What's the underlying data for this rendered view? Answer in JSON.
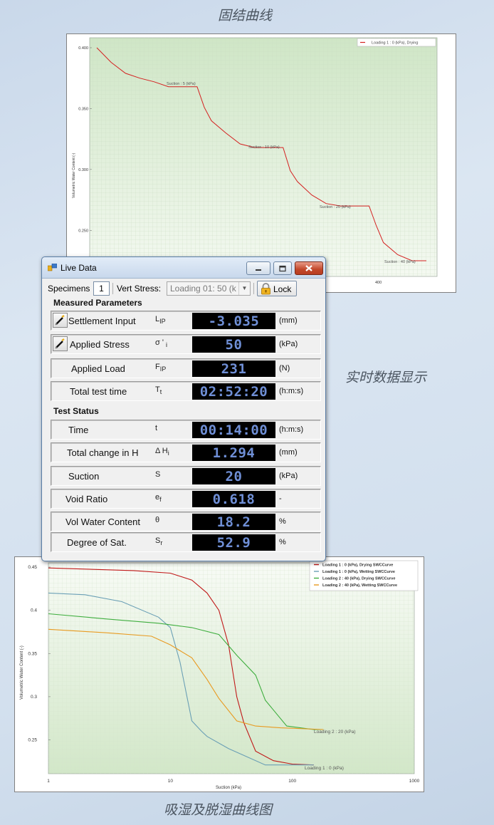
{
  "captions": {
    "consolidation": "固结曲线",
    "live": "实时数据显示",
    "swcc": "吸湿及脱湿曲线图"
  },
  "top_chart": {
    "legend": "Loading 1 : 0 (kPa), Drying",
    "ylabel": "Volumetric Water Content (-)",
    "yticks": [
      "0.400",
      "0.350",
      "0.300",
      "0.250"
    ],
    "xticks": [
      "400"
    ],
    "annotations": [
      "Suction : 5 (kPa)",
      "Suction : 10 (kPa)",
      "Suction : 20 (kPa)",
      "Suction : 40 (kPa)"
    ],
    "line_color": "#d42020"
  },
  "window": {
    "title": "Live Data",
    "specimens_label": "Specimens",
    "specimens_value": "1",
    "vert_stress_label": "Vert Stress:",
    "vert_stress_value": "Loading 01: 50 (k",
    "lock_label": "Lock",
    "measured_title": "Measured Parameters",
    "status_title": "Test Status",
    "measured": [
      {
        "name": "Settlement Input",
        "sym": "L",
        "sub": "IP",
        "value": "-3.035",
        "unit": "(mm)"
      },
      {
        "name": "Applied Stress",
        "sym": "σ ' ",
        "sub": "i",
        "value": "50",
        "unit": "(kPa)"
      },
      {
        "name": "Applied Load",
        "sym": "F",
        "sub": "IP",
        "value": "231",
        "unit": "(N)"
      },
      {
        "name": "Total test time",
        "sym": "T",
        "sub": "t",
        "value": "02:52:20",
        "unit": "(h:m:s)"
      }
    ],
    "status": [
      {
        "name": "Time",
        "sym": "t",
        "sub": "",
        "value": "00:14:00",
        "unit": "(h:m:s)"
      },
      {
        "name": "Total change in H",
        "sym": "Δ H",
        "sub": "i",
        "value": "1.294",
        "unit": "(mm)"
      },
      {
        "name": "Suction",
        "sym": "S",
        "sub": "",
        "value": "20",
        "unit": "(kPa)"
      },
      {
        "name": "Void Ratio",
        "sym": "e",
        "sub": "f",
        "value": "0.618",
        "unit": "-"
      },
      {
        "name": "Vol Water Content",
        "sym": "θ",
        "sub": "",
        "value": "18.2",
        "unit": "%"
      },
      {
        "name": "Degree of Sat.",
        "sym": "S",
        "sub": "r",
        "value": "52.9",
        "unit": "%"
      }
    ]
  },
  "chart_data": [
    {
      "type": "line",
      "ylabel": "Volumetric Water Content (-)",
      "series": [
        {
          "name": "Loading 1 : 0 (kPa), Drying",
          "x": [
            0,
            20,
            40,
            60,
            80,
            100,
            120,
            140,
            150,
            160,
            180,
            200,
            220,
            240,
            260,
            270,
            280,
            300,
            320,
            340,
            360,
            380,
            390,
            400,
            420,
            440,
            460
          ],
          "y": [
            0.4,
            0.388,
            0.379,
            0.375,
            0.372,
            0.368,
            0.368,
            0.368,
            0.351,
            0.34,
            0.33,
            0.321,
            0.318,
            0.318,
            0.318,
            0.299,
            0.29,
            0.279,
            0.272,
            0.27,
            0.27,
            0.27,
            0.254,
            0.24,
            0.23,
            0.225,
            0.225
          ]
        }
      ],
      "annotations": [
        "Suction : 5 (kPa)",
        "Suction : 10 (kPa)",
        "Suction : 20 (kPa)",
        "Suction : 40 (kPa)"
      ]
    },
    {
      "type": "line",
      "xscale": "log",
      "xlabel": "Suction (kPa)",
      "ylabel": "Volumetric Water Content (-)",
      "xlim": [
        1,
        1000
      ],
      "ylim": [
        0.21,
        0.45
      ],
      "xticks": [
        "1",
        "10",
        "100",
        "1000"
      ],
      "yticks": [
        "0.45",
        "0.4",
        "0.35",
        "0.3",
        "0.25"
      ],
      "series": [
        {
          "name": "Loading 1 : 0 (kPa), Drying SWCCurve",
          "color": "#c01818",
          "x": [
            1,
            5,
            10,
            15,
            20,
            25,
            30,
            35,
            40,
            50,
            70,
            100,
            150
          ],
          "y": [
            0.449,
            0.446,
            0.443,
            0.435,
            0.42,
            0.4,
            0.36,
            0.3,
            0.27,
            0.237,
            0.226,
            0.222,
            0.221
          ]
        },
        {
          "name": "Loading 1 : 0 (kPa), Wetting SWCCurve",
          "color": "#6a9fb5",
          "x": [
            1,
            2,
            4,
            8,
            10,
            12,
            15,
            18,
            20,
            30,
            60,
            100,
            150
          ],
          "y": [
            0.42,
            0.418,
            0.41,
            0.392,
            0.38,
            0.34,
            0.272,
            0.26,
            0.254,
            0.24,
            0.221,
            0.221,
            0.221
          ]
        },
        {
          "name": "Loading 2 : 40 (kPa), Drying SWCCurve",
          "color": "#3fae3f",
          "x": [
            1,
            3,
            8,
            15,
            25,
            35,
            50,
            60,
            90,
            150,
            180
          ],
          "y": [
            0.396,
            0.39,
            0.385,
            0.38,
            0.372,
            0.348,
            0.325,
            0.296,
            0.266,
            0.262,
            0.262
          ]
        },
        {
          "name": "Loading 2 : 40 (kPa), Wetting SWCCurve",
          "color": "#e89a20",
          "x": [
            1,
            3,
            7,
            10,
            15,
            20,
            25,
            35,
            50,
            80,
            180
          ],
          "y": [
            0.378,
            0.374,
            0.37,
            0.36,
            0.345,
            0.32,
            0.298,
            0.272,
            0.266,
            0.264,
            0.262
          ]
        }
      ],
      "annotations": [
        "Loading 2 : 20 (kPa)",
        "Loading 1 : 0 (kPa)"
      ]
    }
  ]
}
